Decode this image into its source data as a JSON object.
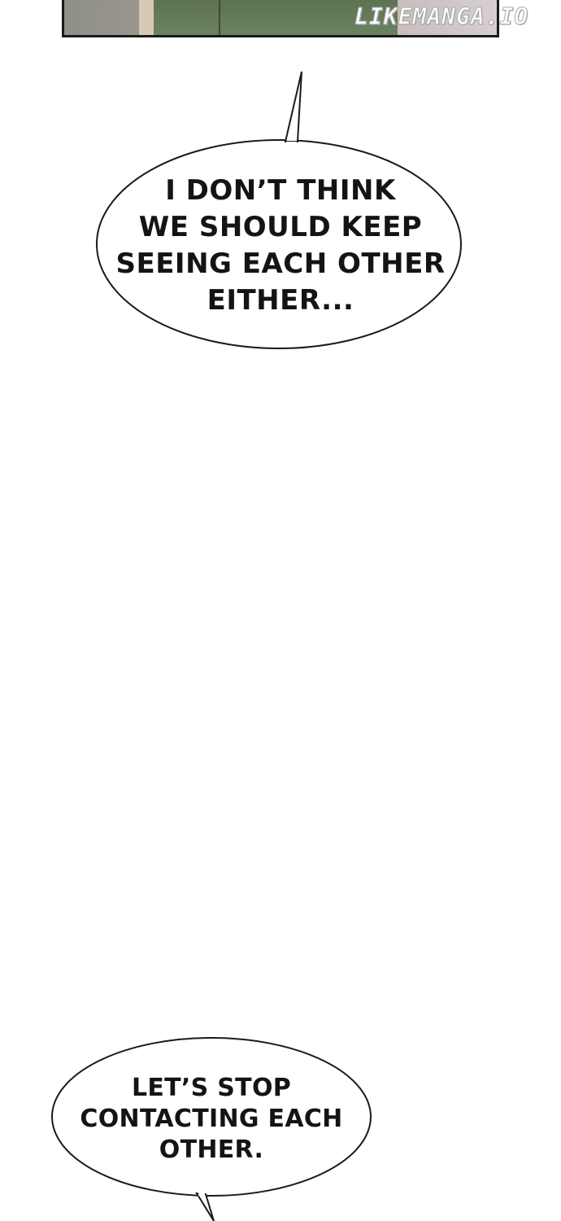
{
  "watermark": "LIKEMANGA.IO",
  "bubbles": [
    {
      "id": "bubble-1",
      "text": "I DON’T THINK\nWE SHOULD KEEP\nSEEING EACH OTHER\nEITHER..."
    },
    {
      "id": "bubble-2",
      "text": "LET’S STOP\nCONTACTING EACH\nOTHER."
    }
  ],
  "colors": {
    "background": "#ffffff",
    "ink": "#141414",
    "bubble_fill": "#ffffff",
    "panel_border": "#1a1a1a"
  }
}
